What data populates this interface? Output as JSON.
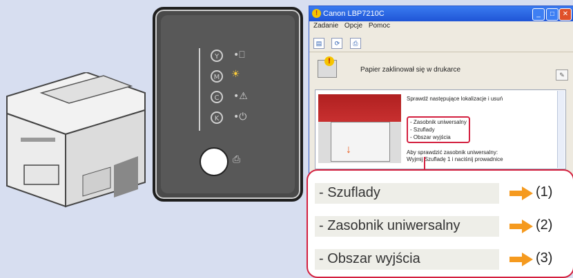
{
  "window": {
    "title": "Canon LBP7210C",
    "menus": [
      "Zadanie",
      "Opcje",
      "Pomoc"
    ],
    "status_message": "Papier zaklinował się w drukarce",
    "instruction": "Sprawdź następujące lokalizacje i usuń",
    "locations": [
      "- Zasobnik uniwersalny",
      "- Szuflady",
      "- Obszar wyjścia"
    ],
    "instruction2": "Aby sprawdzić zasobnik uniwersalny:",
    "instruction3": "Wyjmij Szufladę 1 i naciśnij prowadnice"
  },
  "callout": {
    "items": [
      {
        "label": "- Szuflady",
        "num": "(1)"
      },
      {
        "label": "- Zasobnik uniwersalny",
        "num": "(2)"
      },
      {
        "label": "- Obszar wyjścia",
        "num": "(3)"
      }
    ]
  },
  "colors": {
    "accent": "#d31f3e",
    "arrow": "#f59a1f",
    "titlebar": "#1f55d6"
  }
}
